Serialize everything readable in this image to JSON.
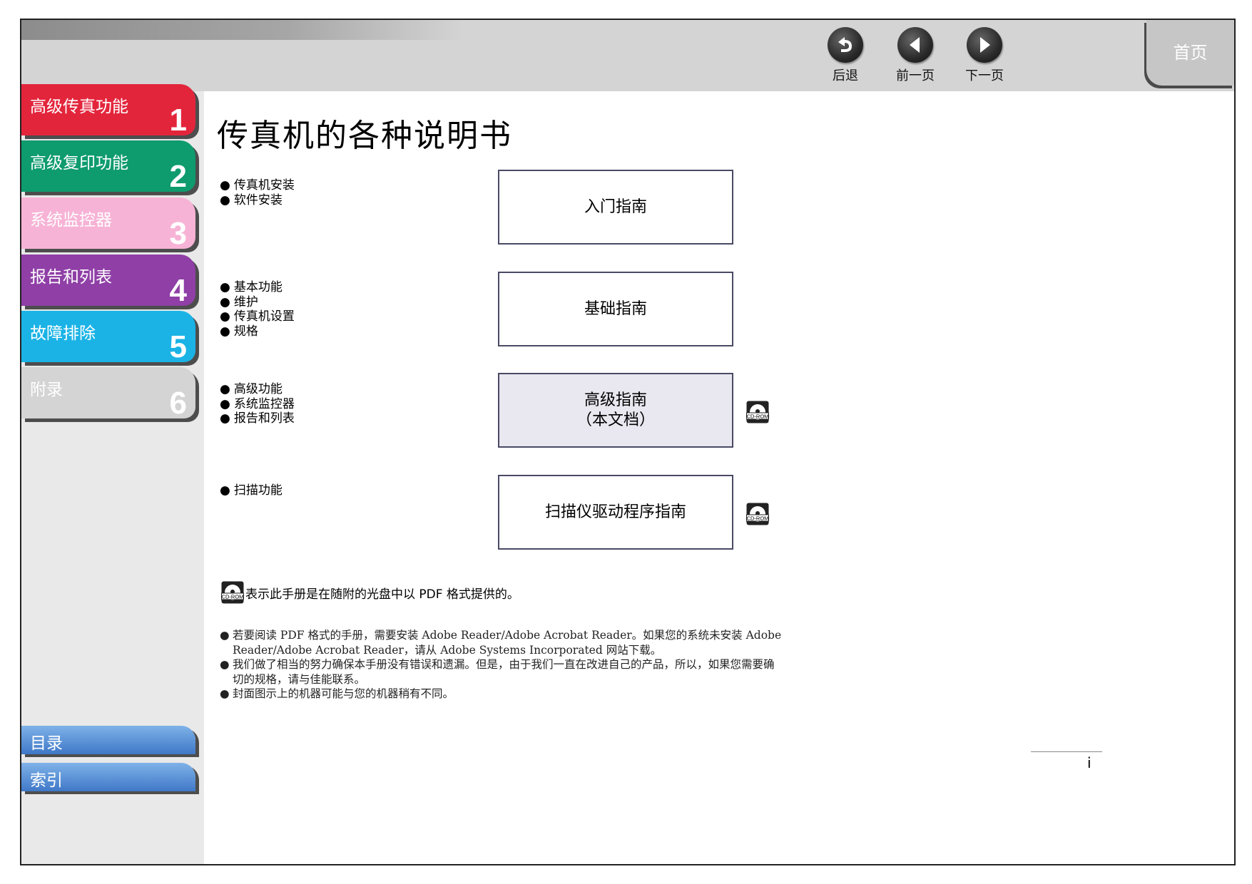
{
  "nav": {
    "back_label": "后退",
    "prev_label": "前一页",
    "next_label": "下一页",
    "home_label": "首页"
  },
  "sidebar": {
    "chapters": [
      {
        "title": "高级传真功能",
        "number": "1",
        "color": "#e3253c"
      },
      {
        "title": "高级复印功能",
        "number": "2",
        "color": "#0e9b6e"
      },
      {
        "title": "系统监控器",
        "number": "3",
        "color": "#f7b3d6"
      },
      {
        "title": "报告和列表",
        "number": "4",
        "color": "#8f3fa6"
      },
      {
        "title": "故障排除",
        "number": "5",
        "color": "#1bb3e6"
      },
      {
        "title": "附录",
        "number": "6",
        "color": "#d4d4d4"
      }
    ],
    "contents_label": "目录",
    "index_label": "索引"
  },
  "main": {
    "title": "传真机的各种说明书",
    "guides": [
      {
        "name": "入门指南",
        "bullets": [
          "传真机安装",
          "软件安装"
        ],
        "cdrom": false
      },
      {
        "name": "基础指南",
        "bullets": [
          "基本功能",
          "维护",
          "传真机设置",
          "规格"
        ],
        "cdrom": false
      },
      {
        "name": "高级指南",
        "subname": "（本文档）",
        "bullets": [
          "高级功能",
          "系统监控器",
          "报告和列表"
        ],
        "cdrom": true
      },
      {
        "name": "扫描仪驱动程序指南",
        "bullets": [
          "扫描功能"
        ],
        "cdrom": true
      }
    ],
    "cdrom_icon_text": "CD-ROM",
    "cdrom_note": "表示此手册是在随附的光盘中以 PDF 格式提供的。",
    "notes": [
      "若要阅读 PDF 格式的手册，需要安装 Adobe Reader/Adobe Acrobat Reader。如果您的系统未安装 Adobe Reader/Adobe Acrobat Reader，请从 Adobe Systems Incorporated 网站下载。",
      "我们做了相当的努力确保本手册没有错误和遗漏。但是，由于我们一直在改进自己的产品，所以，如果您需要确切的规格，请与佳能联系。",
      "封面图示上的机器可能与您的机器稍有不同。"
    ]
  },
  "page_number": "i",
  "colors": {
    "highlight_box": "#e9e7ef",
    "box_border": "#4a4a66",
    "footer_button": "#4a84d0"
  }
}
